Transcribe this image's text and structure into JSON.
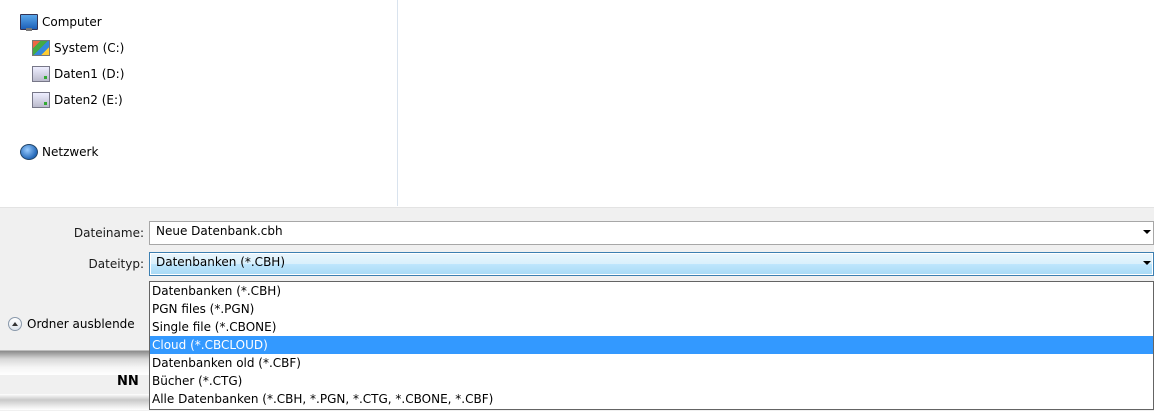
{
  "nav": {
    "computer": "Computer",
    "drives": [
      "System (C:)",
      "Daten1 (D:)",
      "Daten2 (E:)"
    ],
    "network": "Netzwerk"
  },
  "form": {
    "filename_label": "Dateiname:",
    "filename_value": "Neue Datenbank.cbh",
    "filetype_label": "Dateityp:",
    "filetype_value": "Datenbanken (*.CBH)"
  },
  "dropdown": {
    "options": [
      "Datenbanken (*.CBH)",
      "PGN files (*.PGN)",
      "Single file (*.CBONE)",
      "Cloud (*.CBCLOUD)",
      "Datenbanken old (*.CBF)",
      "Bücher (*.CTG)",
      "Alle Datenbanken (*.CBH, *.PGN, *.CTG, *.CBONE, *.CBF)"
    ],
    "selected_index": 3
  },
  "toggle": {
    "label": "Ordner ausblende"
  },
  "background_text": {
    "nn": "NN"
  },
  "colors": {
    "selection": "#3399ff",
    "focus_border": "#3c7fb1"
  }
}
